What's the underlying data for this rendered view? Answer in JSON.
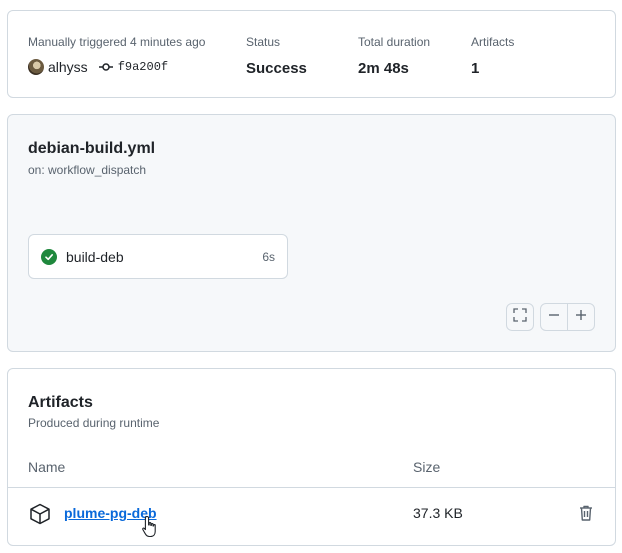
{
  "summary": {
    "trigger_label": "Manually triggered 4 minutes ago",
    "actor": "alhyss",
    "commit": "f9a200f",
    "status_label": "Status",
    "status_value": "Success",
    "duration_label": "Total duration",
    "duration_value": "2m 48s",
    "artifacts_label": "Artifacts",
    "artifacts_value": "1"
  },
  "workflow": {
    "file": "debian-build.yml",
    "trigger": "on: workflow_dispatch",
    "jobs": [
      {
        "name": "build-deb",
        "duration": "6s",
        "status": "success"
      }
    ],
    "controls": [
      "fullscreen-icon",
      "zoom-out-icon",
      "zoom-in-icon"
    ]
  },
  "artifacts": {
    "title": "Artifacts",
    "subtitle": "Produced during runtime",
    "columns": {
      "name": "Name",
      "size": "Size"
    },
    "rows": [
      {
        "name": "plume-pg-deb",
        "size": "37.3 KB"
      }
    ]
  },
  "colors": {
    "success": "#1f883d",
    "link": "#0969da",
    "border": "#d1d9e0",
    "muted": "#59636e"
  }
}
